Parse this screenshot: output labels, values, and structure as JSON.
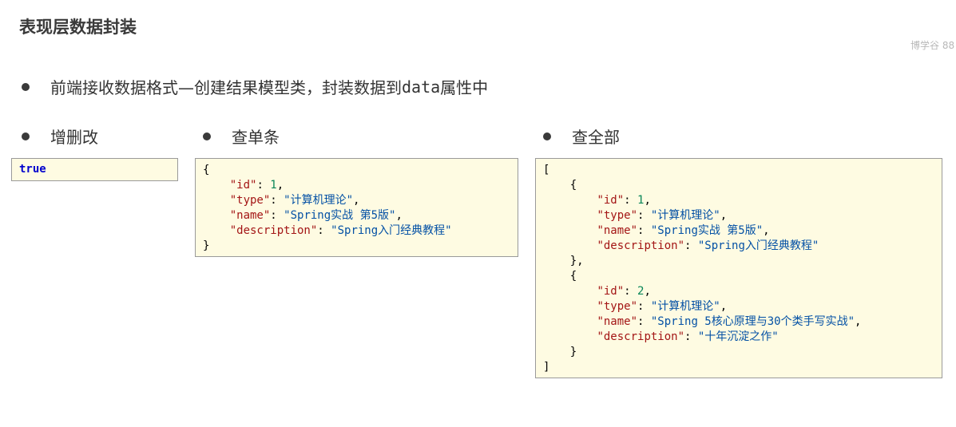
{
  "title": "表现层数据封装",
  "watermark": "博学谷 88",
  "intro": {
    "prefix": "前端接收数据格式—创建结果模型类，封装数据到",
    "code": "data",
    "suffix": "属性中"
  },
  "sections": {
    "update": {
      "heading": "增删改",
      "value": "true"
    },
    "single": {
      "heading": "查单条",
      "open": "{",
      "close": "}",
      "fields": [
        {
          "key": "\"id\"",
          "value": "1",
          "sep": ","
        },
        {
          "key": "\"type\"",
          "value": "\"计算机理论\"",
          "sep": ","
        },
        {
          "key": "\"name\"",
          "value": "\"Spring实战 第5版\"",
          "sep": ","
        },
        {
          "key": "\"description\"",
          "value": "\"Spring入门经典教程\"",
          "sep": ""
        }
      ]
    },
    "all": {
      "heading": "查全部",
      "open": "[",
      "close": "]",
      "obj_open": "{",
      "obj1_close": "},",
      "obj2_close": "}",
      "items": [
        [
          {
            "key": "\"id\"",
            "value": "1",
            "sep": ","
          },
          {
            "key": "\"type\"",
            "value": "\"计算机理论\"",
            "sep": ","
          },
          {
            "key": "\"name\"",
            "value": "\"Spring实战 第5版\"",
            "sep": ","
          },
          {
            "key": "\"description\"",
            "value": "\"Spring入门经典教程\"",
            "sep": ""
          }
        ],
        [
          {
            "key": "\"id\"",
            "value": "2",
            "sep": ","
          },
          {
            "key": "\"type\"",
            "value": "\"计算机理论\"",
            "sep": ","
          },
          {
            "key": "\"name\"",
            "value": "\"Spring 5核心原理与30个类手写实战\"",
            "sep": ","
          },
          {
            "key": "\"description\"",
            "value": "\"十年沉淀之作\"",
            "sep": ""
          }
        ]
      ]
    }
  }
}
